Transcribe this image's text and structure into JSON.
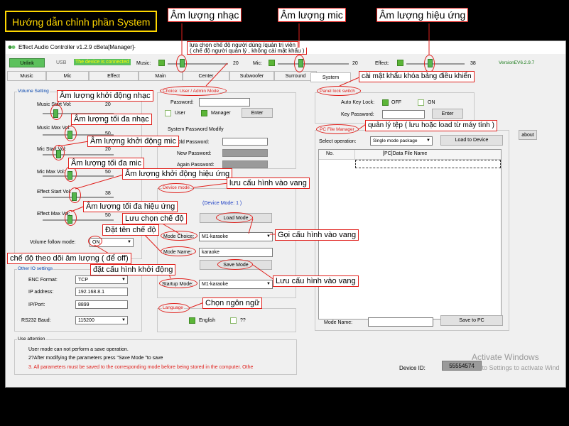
{
  "guide_title": "Hướng dẫn chỉnh phần System",
  "window": {
    "title": "Effect Audio Controller  v1.2.9 cBeta[Manager]-",
    "version": "VersionEV6.2.9.7"
  },
  "top": {
    "unlink": "Unlink",
    "usb": "USB",
    "status": "The device is connected",
    "music_label": "Music:",
    "music_value": "20",
    "mic_label": "Mic:",
    "mic_value": "20",
    "effect_label": "Effect:",
    "effect_value": "38"
  },
  "tabs": [
    "Music",
    "Mic",
    "Effect",
    "Main",
    "Center",
    "Subwoofer",
    "Surround",
    "System"
  ],
  "volume_setting": {
    "title": "Volume Setting",
    "music_start": {
      "label": "Music Start Vol:",
      "value": "20"
    },
    "music_max": {
      "label": "Music Max Vol:",
      "value": "50"
    },
    "mic_start": {
      "label": "Mic Start Vol:",
      "value": "20"
    },
    "mic_max": {
      "label": "Mic Max Vol:",
      "value": "50"
    },
    "effect_start": {
      "label": "Effect Start Vol:",
      "value": "38"
    },
    "effect_max": {
      "label": "Effect Max Vol:",
      "value": "50"
    },
    "follow_label": "Volume follow mode:",
    "follow_value": "ON"
  },
  "other_io": {
    "title": "Other IO settings",
    "enc_label": "ENC Format:",
    "enc_value": "TCP",
    "ip_label": "IP address:",
    "ip_value": "192.168.8.1",
    "port_label": "IP/Port:",
    "port_value": "8899",
    "baud_label": "RS232 Baud:",
    "baud_value": "115200"
  },
  "user_admin": {
    "title": "Choice: User / Admin Mode",
    "password_label": "Password:",
    "user": "User",
    "manager": "Manager",
    "enter": "Enter",
    "sys_pw": "System Password Modify",
    "old_pw": "Old Password:",
    "new_pw": "New Password:",
    "again_pw": "Again Password:"
  },
  "device_mode": {
    "title": "Device mode",
    "mode_text": "(Device Mode: 1 )",
    "load_mode": "Load Mode",
    "mode_choice_label": "Mode Choice:",
    "mode_choice_value": "M1-karaoke",
    "mode_name_label": "Mode Name:",
    "mode_name_value": "karaoke",
    "save_mode": "Save Mode",
    "startup_label": "Startup Mode:",
    "startup_value": "M1-karaoke"
  },
  "language": {
    "title": "Language",
    "english": "English",
    "other": "??"
  },
  "panel_lock": {
    "title": "Panel lock switch",
    "auto_label": "Auto Key Lock:",
    "off": "OFF",
    "on": "ON",
    "key_pw": "Key Password:",
    "enter": "Enter"
  },
  "pc_file": {
    "title": "PC File Manager",
    "select_label": "Select operation:",
    "select_value": "Single mode package",
    "load_btn": "Load to Device",
    "col_no": "No.",
    "col_name": "[PC]Data File Name",
    "mode_name_label": "Mode Name:",
    "save_btn": "Save to PC"
  },
  "about": "about",
  "attention": {
    "title": "Use attention",
    "line1": "User mode can not perform a save operation.",
    "line2": "2?After modifying the parameters press \"Save Mode \"to save",
    "line3": "3. All parameters must be saved to the corresponding mode before being stored in the computer. Othe"
  },
  "device_id_label": "Device ID:",
  "device_id_value": "55554574",
  "activate": {
    "line1": "Activate Windows",
    "line2": "Go to Settings to activate Wind"
  },
  "annotations": {
    "am_luong_nhac": "Âm lượng nhạc",
    "am_luong_mic": "Âm lượng mic",
    "am_luong_hieu_ung": "Âm lượng hiệu ứng",
    "lua_chon_line1": "lựa chọn chế độ người dùng /quản trị viên",
    "lua_chon_line2": "( chế độ người quản lý , không cài mật khẩu )",
    "cai_mat_khau": "cài mật khẩu khóa bảng điều khiển",
    "quan_ly_tep": "quản lý tệp ( lưu hoặc load từ máy tính )",
    "khoi_dong_nhac": "Âm lượng khởi động nhạc",
    "toi_da_nhac": "Âm lượng tối đa nhạc",
    "khoi_dong_mic": "Âm lượng khởi động mic",
    "toi_da_mic": "Âm lượng tối đa mic",
    "khoi_dong_hieu_ung": "Âm lượng khởi động hiệu ứng",
    "toi_da_hieu_ung": "Âm lượng tối đa hiệu ứng",
    "luu_cau_hinh": "lưu cấu hình vào vang",
    "luu_chon_che_do": "Lưu chọn chế độ",
    "dat_ten": "Đặt tên chế độ",
    "goi_cau_hinh": "Gọi cấu hình vào vang",
    "che_do_theo_doi": "chế độ theo dõi âm lượng ( để off)",
    "dat_khoi_dong": "đặt cấu hình khởi động",
    "luu_cau_hinh2": "Lưu cấu hình vào vang",
    "chon_ngon_ngu": "Chọn ngôn ngữ"
  }
}
